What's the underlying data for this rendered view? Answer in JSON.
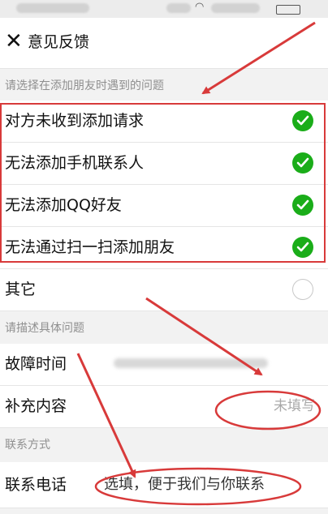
{
  "header": {
    "close_icon": "close-icon",
    "title": "意见反馈"
  },
  "sections": {
    "issue_prompt": "请选择在添加朋友时遇到的问题",
    "describe_prompt": "请描述具体问题",
    "contact_prompt": "联系方式"
  },
  "options": [
    {
      "label": "对方未收到添加请求",
      "selected": true
    },
    {
      "label": "无法添加手机联系人",
      "selected": true
    },
    {
      "label": "无法添加QQ好友",
      "selected": true
    },
    {
      "label": "无法通过扫一扫添加朋友",
      "selected": true
    },
    {
      "label": "其它",
      "selected": false
    }
  ],
  "details": {
    "fault_time_label": "故障时间",
    "supplement_label": "补充内容",
    "supplement_value": "未填写"
  },
  "contact": {
    "phone_label": "联系电话",
    "phone_placeholder": "选填，便于我们与你联系"
  },
  "colors": {
    "check_green": "#1aad19",
    "annotation_red": "#d83a3a"
  }
}
